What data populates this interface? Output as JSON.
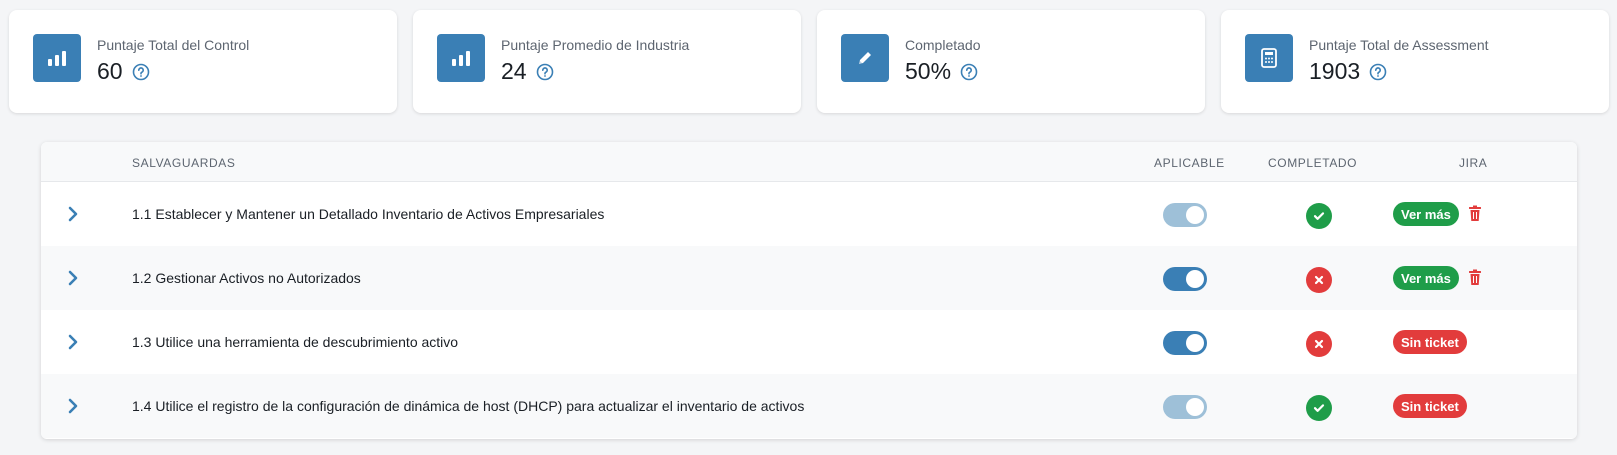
{
  "stats": [
    {
      "label": "Puntaje Total del Control",
      "value": "60",
      "icon": "bar-chart-icon"
    },
    {
      "label": "Puntaje Promedio de Industria",
      "value": "24",
      "icon": "bar-chart-icon"
    },
    {
      "label": "Completado",
      "value": "50%",
      "icon": "pencil-icon"
    },
    {
      "label": "Puntaje Total de Assessment",
      "value": "1903",
      "icon": "calculator-icon"
    }
  ],
  "table": {
    "headers": {
      "safeguards": "SALVAGUARDAS",
      "applicable": "APLICABLE",
      "completed": "COMPLETADO",
      "jira": "JIRA"
    },
    "rows": [
      {
        "label": "1.1 Establecer y Mantener un Detallado Inventario de Activos Empresariales",
        "applicable": true,
        "applicable_style": "dim",
        "completed": true,
        "jira": "Ver más",
        "jira_style": "green",
        "deletable": true
      },
      {
        "label": "1.2 Gestionar Activos no Autorizados",
        "applicable": true,
        "applicable_style": "on",
        "completed": false,
        "jira": "Ver más",
        "jira_style": "green",
        "deletable": true
      },
      {
        "label": "1.3 Utilice una herramienta de descubrimiento activo",
        "applicable": true,
        "applicable_style": "on",
        "completed": false,
        "jira": "Sin ticket",
        "jira_style": "red",
        "deletable": false
      },
      {
        "label": "1.4 Utilice el registro de la configuración de dinámica de host (DHCP) para actualizar el inventario de activos",
        "applicable": true,
        "applicable_style": "dim",
        "completed": true,
        "jira": "Sin ticket",
        "jira_style": "red",
        "deletable": false
      }
    ]
  },
  "colors": {
    "accent": "#3a7fb5",
    "accent_dim": "#9ec0d8",
    "success": "#1f9d49",
    "danger": "#e23c3c"
  }
}
